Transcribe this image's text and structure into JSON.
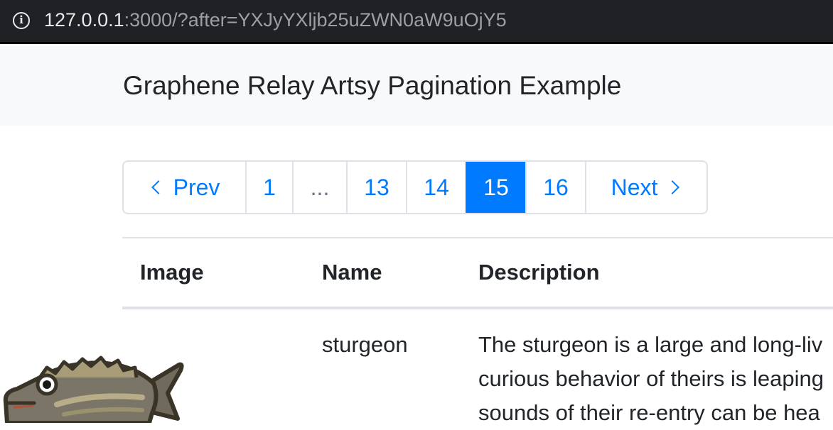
{
  "browser": {
    "url_host": "127.0.0.1",
    "url_rest": ":3000/?after=YXJyYXljb25uZWN0aW9uOjY5",
    "info_icon": "info-icon"
  },
  "header": {
    "title": "Graphene Relay Artsy Pagination Example"
  },
  "pagination": {
    "prev_label": "Prev",
    "next_label": "Next",
    "pages": [
      "1",
      "...",
      "13",
      "14",
      "15",
      "16"
    ],
    "active_page": "15"
  },
  "table": {
    "columns": [
      "Image",
      "Name",
      "Description"
    ],
    "rows": [
      {
        "image_icon": "sturgeon-fish-icon",
        "name": "sturgeon",
        "description_lines": [
          "The sturgeon is a large and long-liv",
          "curious behavior of theirs is leaping",
          "sounds of their re-entry can be hea"
        ]
      }
    ]
  },
  "colors": {
    "accent": "#007bff",
    "header_bg": "#f8f9fa",
    "border": "#dee2e6",
    "text": "#212529"
  }
}
